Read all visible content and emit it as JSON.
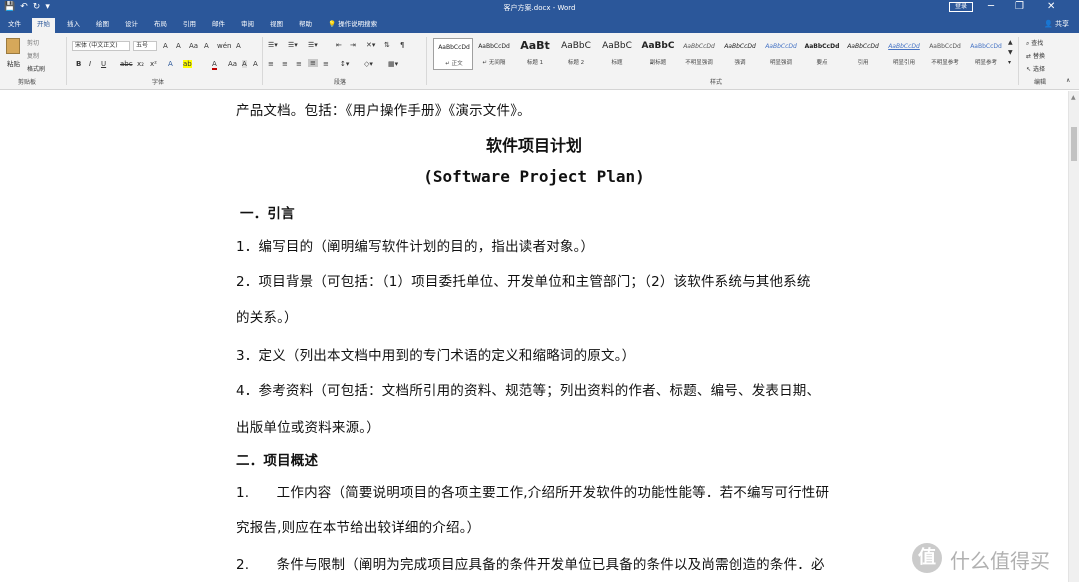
{
  "titlebar": {
    "doc_title": "客户方案.docx - Word",
    "signin": "登录",
    "minimize": "─",
    "restore": "❐",
    "close": "✕"
  },
  "qat": {
    "save": "💾",
    "undo": "↶",
    "redo": "↻",
    "more": "▾"
  },
  "tabs": [
    "文件",
    "开始",
    "插入",
    "绘图",
    "设计",
    "布局",
    "引用",
    "邮件",
    "审阅",
    "视图",
    "帮助",
    "操作说明搜索"
  ],
  "active_tab": "开始",
  "share": "共享",
  "ribbon": {
    "clipboard": {
      "paste": "粘贴",
      "cut": "剪切",
      "copy": "复制",
      "format_painter": "格式刷",
      "label": "剪贴板"
    },
    "font": {
      "name": "宋体 (中文正文)",
      "size": "五号",
      "label": "字体",
      "icons_row1": [
        "A",
        "A",
        "Aa",
        "A",
        "wén",
        "A"
      ],
      "icons_row2": [
        "B",
        "I",
        "U",
        "abc",
        "x₂",
        "x²",
        "A",
        "ab",
        "A",
        "Aa",
        "A",
        "A"
      ]
    },
    "paragraph": {
      "label": "段落"
    },
    "styles": {
      "label": "样式",
      "items": [
        {
          "preview": "AaBbCcDd",
          "name": "↵ 正文"
        },
        {
          "preview": "AaBbCcDd",
          "name": "↵ 无间隔"
        },
        {
          "preview": "AaBt",
          "name": "标题 1"
        },
        {
          "preview": "AaBbC",
          "name": "标题 2"
        },
        {
          "preview": "AaBbC",
          "name": "标题"
        },
        {
          "preview": "AaBbC",
          "name": "副标题"
        },
        {
          "preview": "AaBbCcDd",
          "name": "不明显强调"
        },
        {
          "preview": "AaBbCcDd",
          "name": "强调"
        },
        {
          "preview": "AaBbCcDd",
          "name": "明显强调"
        },
        {
          "preview": "AaBbCcDd",
          "name": "要点"
        },
        {
          "preview": "AaBbCcDd",
          "name": "引用"
        },
        {
          "preview": "AaBbCcDd",
          "name": "明显引用"
        },
        {
          "preview": "AaBbCcDd",
          "name": "不明显参考"
        },
        {
          "preview": "AaBbCcDd",
          "name": "明显参考"
        }
      ]
    },
    "editing": {
      "find": "查找",
      "replace": "替换",
      "select": "选择",
      "label": "编辑"
    }
  },
  "document": {
    "title": "软件项目计划",
    "subtitle": "(Software Project Plan)",
    "paragraphs": [
      "产品文档。包括：《用户操作手册》《演示文件》。",
      "一．引言",
      "1．编写目的（阐明编写软件计划的目的，指出读者对象。）",
      "2．项目背景（可包括：（1）项目委托单位、开发单位和主管部门；（2）该软件系统与其他系统",
      "的关系。）",
      "3．定义（列出本文档中用到的专门术语的定义和缩略词的原文。）",
      "4．参考资料（可包括：文档所引用的资料、规范等；列出资料的作者、标题、编号、发表日期、",
      "出版单位或资料来源。）",
      "二．项目概述",
      "1.　　工作内容（简要说明项目的各项主要工作,介绍所开发软件的功能性能等．若不编写可行性研",
      "究报告,则应在本节给出较详细的介绍。）",
      "2.　　条件与限制（阐明为完成项目应具备的条件开发单位已具备的条件以及尚需创造的条件．必"
    ]
  },
  "watermark": {
    "logo": "值",
    "text": "什么值得买"
  }
}
